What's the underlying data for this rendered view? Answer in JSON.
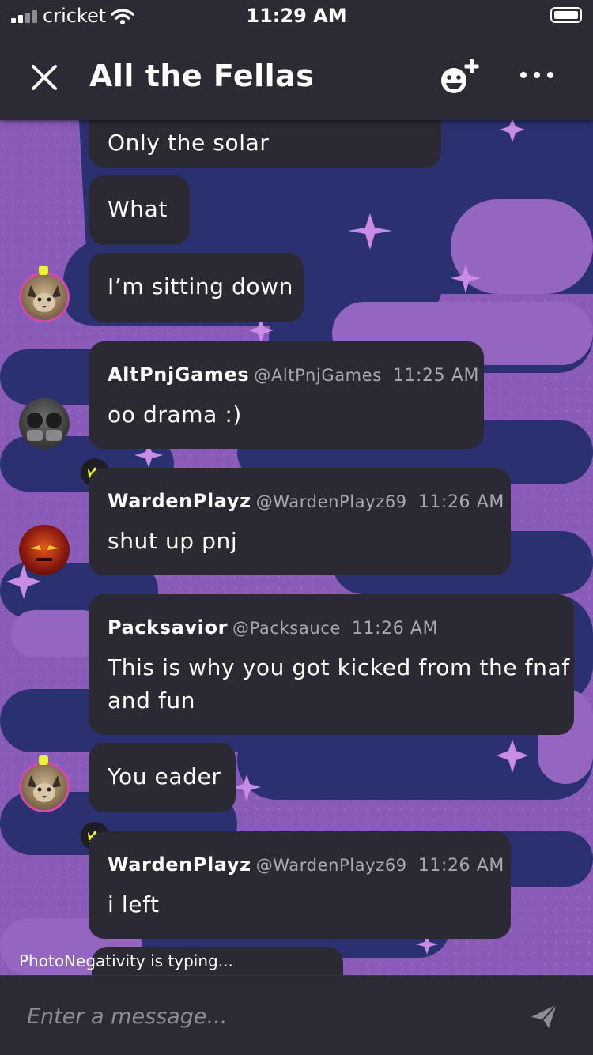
{
  "status_bar": {
    "carrier": "cricket",
    "time": "11:29 AM"
  },
  "header": {
    "title": "All the Fellas",
    "icons": [
      "close-icon",
      "add-member-icon",
      "more-icon"
    ]
  },
  "messages": [
    {
      "text": "Only the solar"
    },
    {
      "text": "What"
    },
    {
      "text": "I’m sitting down"
    },
    {
      "name": "AltPnjGames",
      "handle": "@AltPnjGames",
      "time": "11:25 AM",
      "text": "oo drama :)"
    },
    {
      "name": "WardenPlayz",
      "handle": "@WardenPlayz69",
      "time": "11:26 AM",
      "text": "shut up pnj"
    },
    {
      "name": "Packsavior",
      "handle": "@Packsauce",
      "time": "11:26 AM",
      "text_line1": "This is why you got kicked from the fnaf",
      "text_line2": "and fun"
    },
    {
      "text": "You eader"
    },
    {
      "name": "WardenPlayz",
      "handle": "@WardenPlayz69",
      "time": "11:26 AM",
      "text": "i left"
    }
  ],
  "typing_indicator": "PhotoNegativity is typing...",
  "composer": {
    "placeholder": "Enter a message..."
  },
  "colors": {
    "bubble": "#2b2a32",
    "header": "#2c2b33",
    "crown": "#e6f33a",
    "bg_purple": "#8858b6",
    "bg_navy": "#2a3070"
  }
}
